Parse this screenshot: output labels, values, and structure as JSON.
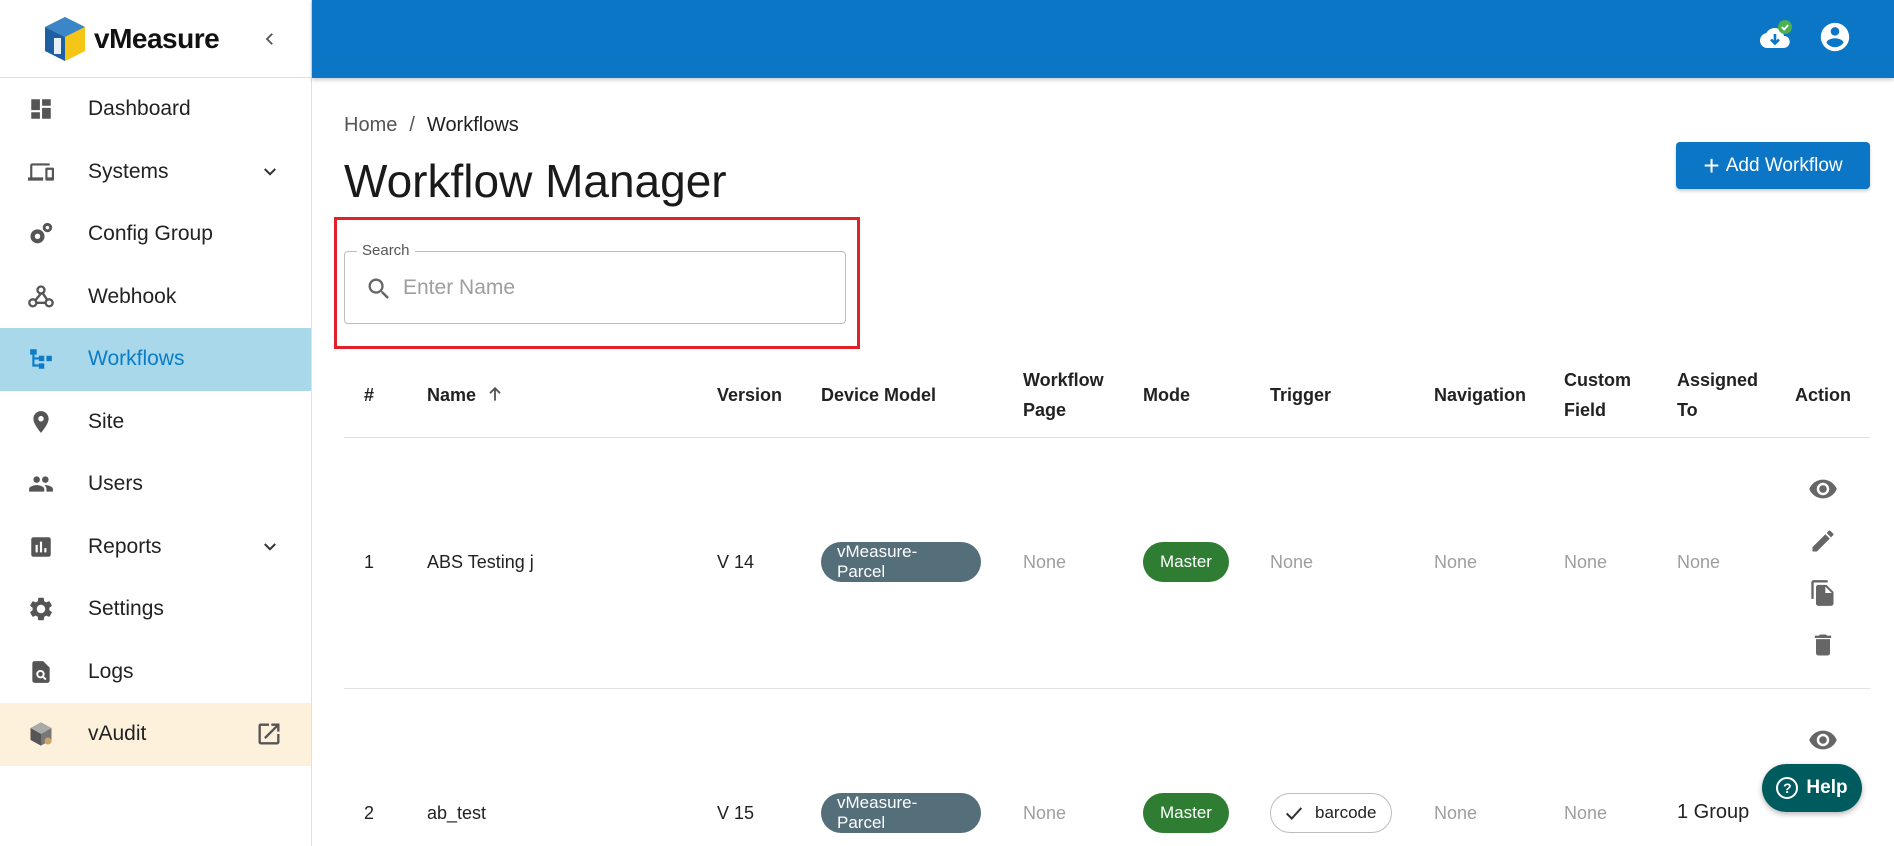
{
  "brand": {
    "name": "vMeasure"
  },
  "sidebar": {
    "items": [
      {
        "label": "Dashboard"
      },
      {
        "label": "Systems"
      },
      {
        "label": "Config Group"
      },
      {
        "label": "Webhook"
      },
      {
        "label": "Workflows"
      },
      {
        "label": "Site"
      },
      {
        "label": "Users"
      },
      {
        "label": "Reports"
      },
      {
        "label": "Settings"
      },
      {
        "label": "Logs"
      },
      {
        "label": "vAudit"
      }
    ]
  },
  "breadcrumb": {
    "home": "Home",
    "separator": "/",
    "current": "Workflows"
  },
  "page": {
    "title": "Workflow Manager",
    "add_button": "Add Workflow"
  },
  "search": {
    "legend": "Search",
    "placeholder": "Enter Name",
    "value": ""
  },
  "table": {
    "headers": {
      "num": "#",
      "name": "Name",
      "version": "Version",
      "device_model": "Device Model",
      "workflow_page_1": "Workflow",
      "workflow_page_2": "Page",
      "mode": "Mode",
      "trigger": "Trigger",
      "navigation": "Navigation",
      "custom_field_1": "Custom",
      "custom_field_2": "Field",
      "assigned_to_1": "Assigned",
      "assigned_to_2": "To",
      "action": "Action"
    },
    "rows": [
      {
        "num": "1",
        "name": "ABS Testing j",
        "version": "V 14",
        "device_model": "vMeasure-Parcel",
        "workflow_page": "None",
        "mode": "Master",
        "trigger": "None",
        "navigation": "None",
        "custom_field": "None",
        "assigned_to": "None"
      },
      {
        "num": "2",
        "name": "ab_test",
        "version": "V 15",
        "device_model": "vMeasure-Parcel",
        "workflow_page": "None",
        "mode": "Master",
        "trigger": "barcode",
        "navigation": "None",
        "custom_field": "None",
        "assigned_to": "1 Group"
      }
    ]
  },
  "help": {
    "label": "Help"
  },
  "colors": {
    "primary": "#0b76c5",
    "active_bg": "#a8d8ea",
    "external_bg": "#fdf1dc",
    "chip_model": "#546e7a",
    "chip_mode": "#2e7d32",
    "help_bg": "#005b5e",
    "highlight": "#e0202a"
  }
}
